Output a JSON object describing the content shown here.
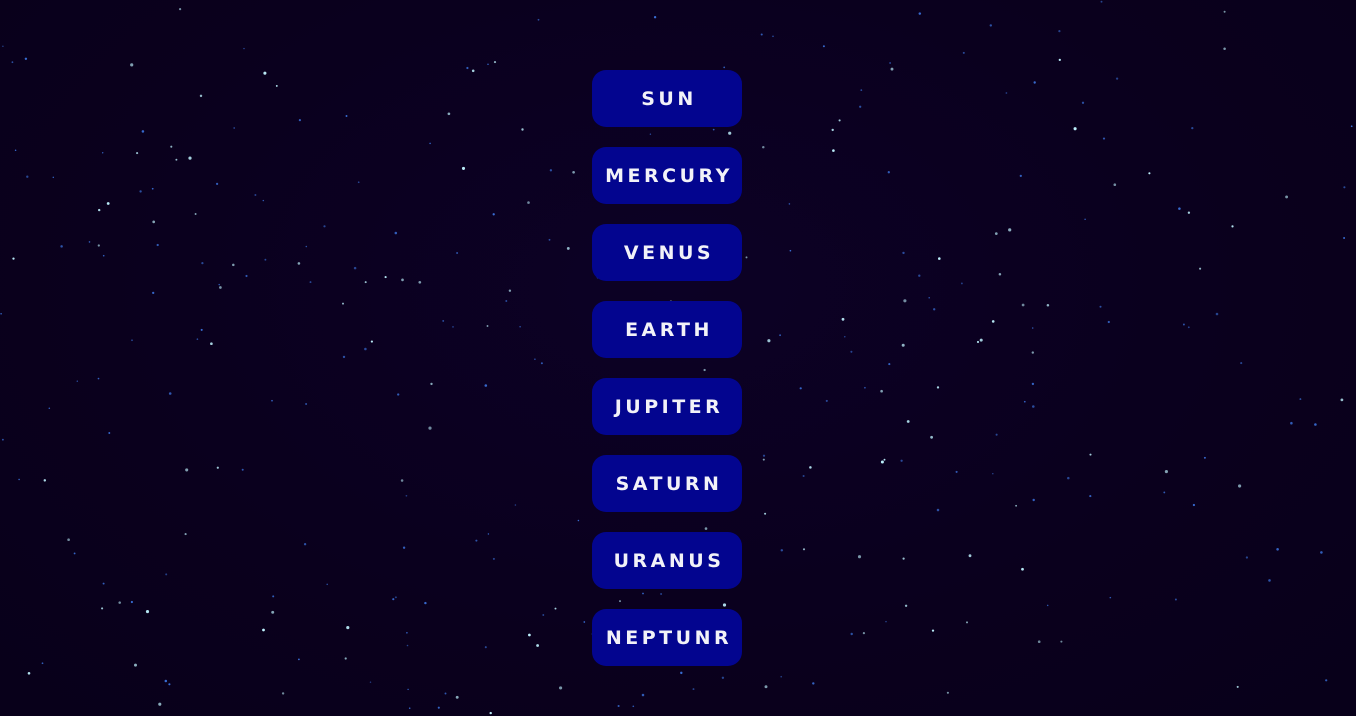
{
  "menu": {
    "items": [
      {
        "label": "SUN"
      },
      {
        "label": "MERCURY"
      },
      {
        "label": "VENUS"
      },
      {
        "label": "EARTH"
      },
      {
        "label": "JUPITER"
      },
      {
        "label": "SATURN"
      },
      {
        "label": "URANUS"
      },
      {
        "label": "NEPTUNR"
      }
    ]
  },
  "colors": {
    "background": "#0a001d",
    "button": "#03058f",
    "button_text": "#f2f2f8",
    "star_bright": "#bff3ff",
    "star_dim": "#3a6fd8"
  },
  "icons": [
    "star-icon"
  ]
}
